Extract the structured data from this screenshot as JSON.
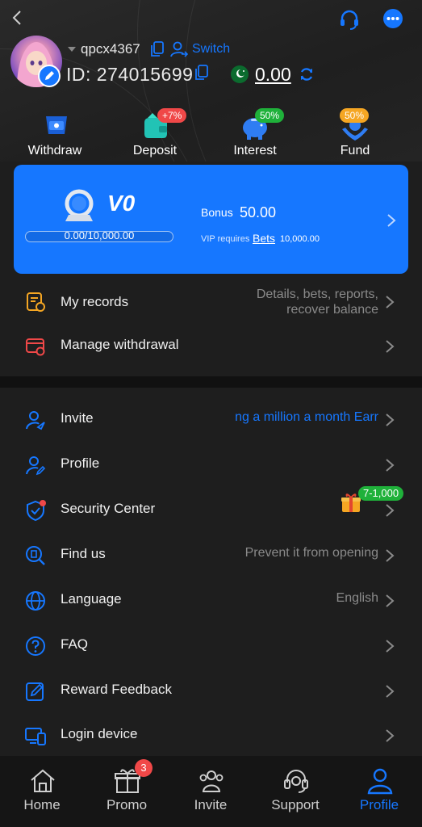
{
  "header": {
    "username": "qpcx4367",
    "switch_label": "Switch",
    "id_label": "ID:",
    "id_value": "274015699",
    "balance": "0.00"
  },
  "shortcuts": [
    {
      "label": "Withdraw",
      "icon": "withdraw-icon",
      "badge": ""
    },
    {
      "label": "Deposit",
      "icon": "deposit-icon",
      "badge": "+7%"
    },
    {
      "label": "Interest",
      "icon": "piggy-bank-icon",
      "badge": "50%"
    },
    {
      "label": "Fund",
      "icon": "fund-icon",
      "badge": "50%"
    }
  ],
  "vip": {
    "level": "V0",
    "progress_text": "0.00/10,000.00",
    "progress_fraction": 0.0,
    "bonus_label": "Bonus",
    "bonus_value": "50.00",
    "requires_label": "VIP requires",
    "requires_link": "Bets",
    "requires_value": "10,000.00"
  },
  "records": {
    "label": "My records",
    "hint_line1": "Details, bets, reports,",
    "hint_line2": "recover balance"
  },
  "manage_withdrawal": {
    "label": "Manage withdrawal"
  },
  "menu": {
    "invite": {
      "label": "Invite",
      "hint": "ng a million a month  Earr"
    },
    "profile": {
      "label": "Profile"
    },
    "security": {
      "label": "Security Center",
      "badge": "7-1,000"
    },
    "findus": {
      "label": "Find us",
      "hint": "Prevent it from opening"
    },
    "language": {
      "label": "Language",
      "hint": "English"
    },
    "faq": {
      "label": "FAQ"
    },
    "feedback": {
      "label": "Reward Feedback"
    },
    "login_device": {
      "label": "Login device"
    }
  },
  "nav": {
    "home": "Home",
    "promo": "Promo",
    "promo_badge": "3",
    "invite": "Invite",
    "support": "Support",
    "profile": "Profile"
  },
  "colors": {
    "accent": "#1677ff",
    "background": "#1e1e1e",
    "badge_red": "#f04848",
    "badge_green": "#1fb13a",
    "badge_orange": "#f5a623"
  }
}
